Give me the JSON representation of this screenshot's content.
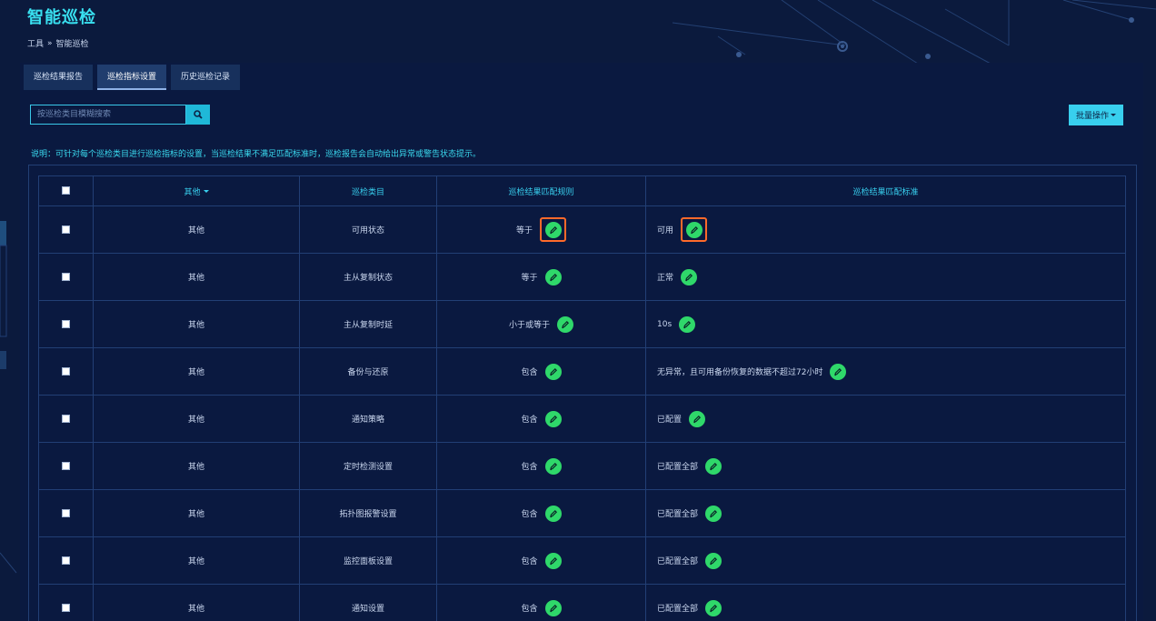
{
  "page": {
    "title": "智能巡检"
  },
  "breadcrumb": {
    "parent": "工具",
    "separator": "»",
    "current": "智能巡检"
  },
  "tabs": [
    {
      "label": "巡检结果报告",
      "active": false
    },
    {
      "label": "巡检指标设置",
      "active": true
    },
    {
      "label": "历史巡检记录",
      "active": false
    }
  ],
  "search": {
    "placeholder": "按巡检类目模糊搜索",
    "value": "",
    "icon": "search-icon"
  },
  "batch": {
    "label": "批量操作"
  },
  "note": "说明：可针对每个巡检类目进行巡检指标的设置，当巡检结果不满足匹配标准时，巡检报告会自动给出异常或警告状态提示。",
  "table": {
    "headers": {
      "type": "其他",
      "item": "巡检类目",
      "rule": "巡检结果匹配规则",
      "std": "巡检结果匹配标准"
    },
    "rows": [
      {
        "type": "其他",
        "item": "可用状态",
        "rule": "等于",
        "std": "可用",
        "highlighted": true
      },
      {
        "type": "其他",
        "item": "主从复制状态",
        "rule": "等于",
        "std": "正常",
        "highlighted": false
      },
      {
        "type": "其他",
        "item": "主从复制时延",
        "rule": "小于或等于",
        "std": "10s",
        "highlighted": false
      },
      {
        "type": "其他",
        "item": "备份与还原",
        "rule": "包含",
        "std": "无异常，且可用备份恢复的数据不超过72小时",
        "highlighted": false
      },
      {
        "type": "其他",
        "item": "通知策略",
        "rule": "包含",
        "std": "已配置",
        "highlighted": false
      },
      {
        "type": "其他",
        "item": "定时检测设置",
        "rule": "包含",
        "std": "已配置全部",
        "highlighted": false
      },
      {
        "type": "其他",
        "item": "拓扑图报警设置",
        "rule": "包含",
        "std": "已配置全部",
        "highlighted": false
      },
      {
        "type": "其他",
        "item": "监控面板设置",
        "rule": "包含",
        "std": "已配置全部",
        "highlighted": false
      },
      {
        "type": "其他",
        "item": "通知设置",
        "rule": "包含",
        "std": "已配置全部",
        "highlighted": false
      }
    ]
  },
  "colors": {
    "accent": "#39e0f0",
    "edit_green": "#2fd86a",
    "highlight": "#ff6a2a",
    "background": "#0b1a3d"
  }
}
